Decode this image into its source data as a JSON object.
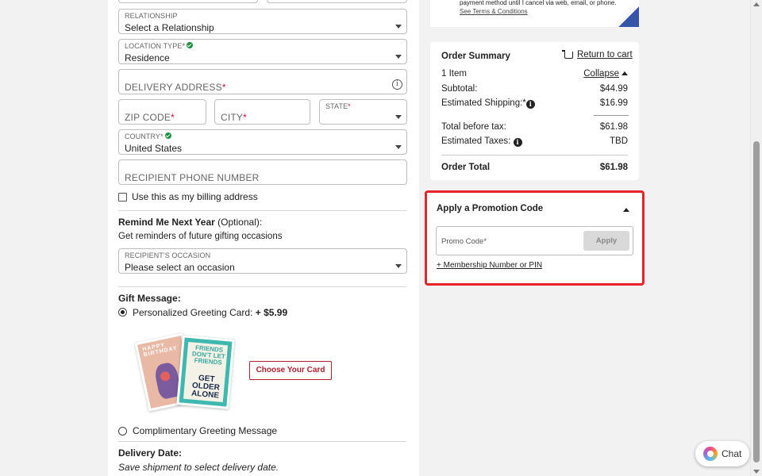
{
  "form": {
    "relationship": {
      "label": "RELATIONSHIP",
      "value": "Select a Relationship"
    },
    "location_type": {
      "label": "LOCATION TYPE",
      "required_mark": "*",
      "value": "Residence"
    },
    "delivery_address": {
      "placeholder": "DELIVERY ADDRESS",
      "required_mark": "*"
    },
    "zip": {
      "placeholder": "ZIP CODE",
      "required_mark": "*"
    },
    "city": {
      "placeholder": "CITY",
      "required_mark": "*"
    },
    "state": {
      "label": "STATE",
      "required_mark": "*",
      "value": ""
    },
    "country": {
      "label": "COUNTRY",
      "required_mark": "*",
      "value": "United States"
    },
    "phone": {
      "placeholder": "RECIPIENT PHONE NUMBER"
    },
    "billing_checkbox_label": "Use this as my billing address",
    "billing_checked": false,
    "remind": {
      "title": "Remind Me Next Year",
      "optional": " (Optional):",
      "subtitle": "Get reminders of future gifting occasions",
      "occasion_label": "RECIPIENT'S OCCASION",
      "occasion_value": "Please select an occasion"
    },
    "gift_message": {
      "title": "Gift Message:",
      "option1_label": "Personalized Greeting Card: ",
      "option1_price": "+ $5.99",
      "choose_card_button": "Choose Your Card",
      "option2_label": "Complimentary Greeting Message",
      "selected": "option1",
      "card_back_text": "HAPPY BIRTHDAY",
      "card_front_top": "FRIENDS DON'T LET FRIENDS",
      "card_front_bottom": "GET OLDER ALONE"
    },
    "delivery_date": {
      "title": "Delivery Date:",
      "note": "Save shipment to select delivery date."
    }
  },
  "promo_banner": {
    "text": "payment method until I cancel via web, email, or phone.",
    "link": "See Terms & Conditions"
  },
  "order_summary": {
    "title": "Order Summary",
    "return_link": "Return to cart",
    "items": "1 Item",
    "collapse": "Collapse",
    "subtotal_label": "Subtotal:",
    "subtotal": "$44.99",
    "shipping_label": "Estimated Shipping:*",
    "shipping": "$16.99",
    "before_tax_label": "Total before tax:",
    "before_tax": "$61.98",
    "taxes_label": "Estimated Taxes:",
    "taxes": "TBD",
    "total_label": "Order Total",
    "total": "$61.98"
  },
  "promotion": {
    "title": "Apply a Promotion Code",
    "placeholder": "Promo Code*",
    "apply": "Apply",
    "membership_link": "+ Membership Number or PIN",
    "highlight_color": "#e5252a"
  },
  "chat": {
    "label": "Chat"
  },
  "colors": {
    "accent_red": "#b01e2f",
    "valid_green": "#1a8f3c"
  }
}
